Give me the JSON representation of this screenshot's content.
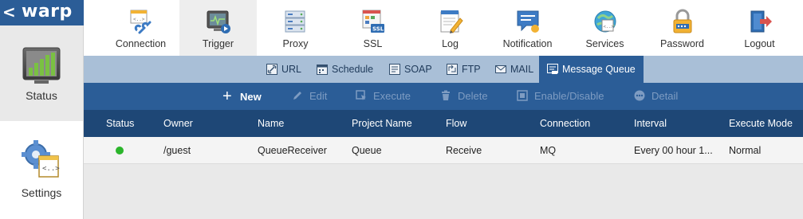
{
  "app": {
    "logo": "warp",
    "back_glyph": "<"
  },
  "sidebar": {
    "items": [
      {
        "label": "Status",
        "icon": "bar-chart-icon"
      },
      {
        "label": "Settings",
        "icon": "gear-document-icon"
      }
    ]
  },
  "topnav": {
    "items": [
      {
        "label": "Connection",
        "icon": "connection-icon"
      },
      {
        "label": "Trigger",
        "icon": "trigger-icon",
        "active": true
      },
      {
        "label": "Proxy",
        "icon": "proxy-icon"
      },
      {
        "label": "SSL",
        "icon": "ssl-icon"
      },
      {
        "label": "Log",
        "icon": "log-icon"
      },
      {
        "label": "Notification",
        "icon": "notification-icon"
      },
      {
        "label": "Services",
        "icon": "services-icon"
      },
      {
        "label": "Password",
        "icon": "password-icon"
      },
      {
        "label": "Logout",
        "icon": "logout-icon"
      }
    ]
  },
  "subtabs": {
    "items": [
      {
        "label": "URL",
        "icon": "link-icon"
      },
      {
        "label": "Schedule",
        "icon": "calendar-icon"
      },
      {
        "label": "SOAP",
        "icon": "soap-icon"
      },
      {
        "label": "FTP",
        "icon": "ftp-icon"
      },
      {
        "label": "MAIL",
        "icon": "mail-icon"
      },
      {
        "label": "Message Queue",
        "icon": "queue-icon",
        "active": true
      }
    ]
  },
  "toolbar": {
    "new_label": "New",
    "new_glyph": "+",
    "edit_label": "Edit",
    "execute_label": "Execute",
    "delete_label": "Delete",
    "enable_label": "Enable/Disable",
    "detail_label": "Detail"
  },
  "table": {
    "columns": [
      "Status",
      "Owner",
      "Name",
      "Project Name",
      "Flow",
      "Connection",
      "Interval",
      "Execute Mode"
    ],
    "rows": [
      {
        "status_color": "#2bb52b",
        "owner": "/guest",
        "name": "QueueReceiver",
        "project": "Queue",
        "flow": "Receive",
        "connection": "MQ",
        "interval": "Every 00 hour 1...",
        "mode": "Normal"
      }
    ]
  },
  "colors": {
    "primary": "#2b5d97",
    "header_dark": "#1e4776",
    "subtab_bar": "#a9bfd7",
    "status_ok": "#2bb52b"
  }
}
